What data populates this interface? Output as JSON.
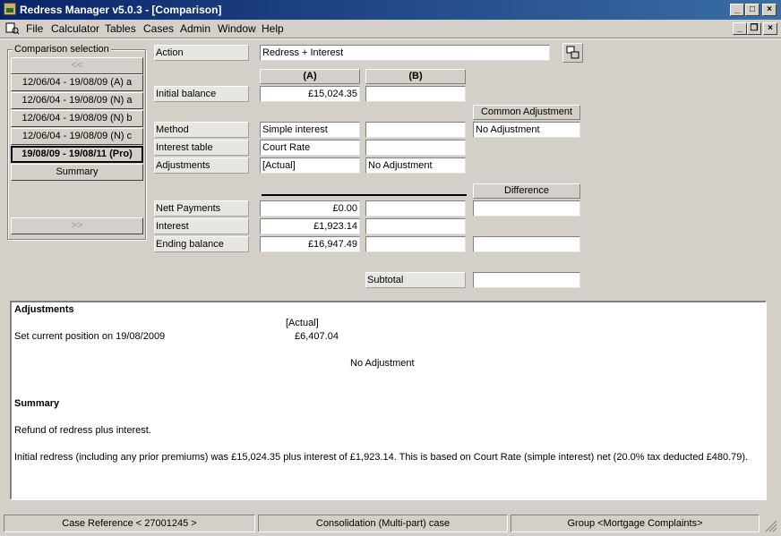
{
  "window": {
    "title": "Redress Manager v5.0.3 - [Comparison]"
  },
  "menu": [
    {
      "label": "File"
    },
    {
      "label": "Calculator"
    },
    {
      "label": "Tables"
    },
    {
      "label": "Cases"
    },
    {
      "label": "Admin"
    },
    {
      "label": "Window"
    },
    {
      "label": "Help"
    }
  ],
  "selection": {
    "group_label": "Comparison selection",
    "prev": "<<",
    "next": ">>",
    "items": [
      {
        "label": "12/06/04 - 19/08/09 (A) a"
      },
      {
        "label": "12/06/04 - 19/08/09 (N) a"
      },
      {
        "label": "12/06/04 - 19/08/09 (N) b"
      },
      {
        "label": "12/06/04 - 19/08/09 (N) c"
      },
      {
        "label": "19/08/09 - 19/08/11 (Pro)"
      },
      {
        "label": "Summary"
      }
    ],
    "selected_index": 4
  },
  "form": {
    "action_label": "Action",
    "action_value": "Redress + Interest",
    "col_a": "(A)",
    "col_b": "(B)",
    "common_adjustment": "Common Adjustment",
    "difference": "Difference",
    "rows": {
      "initial_balance": {
        "label": "Initial balance",
        "a": "£15,024.35",
        "b": ""
      },
      "method": {
        "label": "Method",
        "a": "Simple interest",
        "b": ""
      },
      "interest_table": {
        "label": "Interest table",
        "a": "Court Rate",
        "b": ""
      },
      "adjustments": {
        "label": "Adjustments",
        "a": "[Actual]",
        "b": "No Adjustment"
      },
      "nett_payments": {
        "label": "Nett Payments",
        "a": "£0.00",
        "b": "",
        "diff": ""
      },
      "interest": {
        "label": "Interest",
        "a": "£1,923.14",
        "b": ""
      },
      "ending_balance": {
        "label": "Ending balance",
        "a": "£16,947.49",
        "b": "",
        "diff": ""
      }
    },
    "common_adjustment_value": "No Adjustment",
    "subtotal_label": "Subtotal",
    "subtotal_value": ""
  },
  "report": {
    "adjustments_heading": "Adjustments",
    "actual_label": "[Actual]",
    "position_text": "Set current position on 19/08/2009",
    "position_value": "£6,407.04",
    "no_adjustment": "No Adjustment",
    "summary_heading": "Summary",
    "summary_line1": "Refund of redress plus interest.",
    "summary_line2": "Initial redress (including any prior premiums) was £15,024.35 plus interest of £1,923.14. This is based on Court Rate (simple interest) net (20.0% tax deducted £480.79)."
  },
  "status": {
    "case_reference": "Case Reference < 27001245 >",
    "case_type": "Consolidation (Multi-part) case",
    "group": "Group <Mortgage Complaints>"
  }
}
